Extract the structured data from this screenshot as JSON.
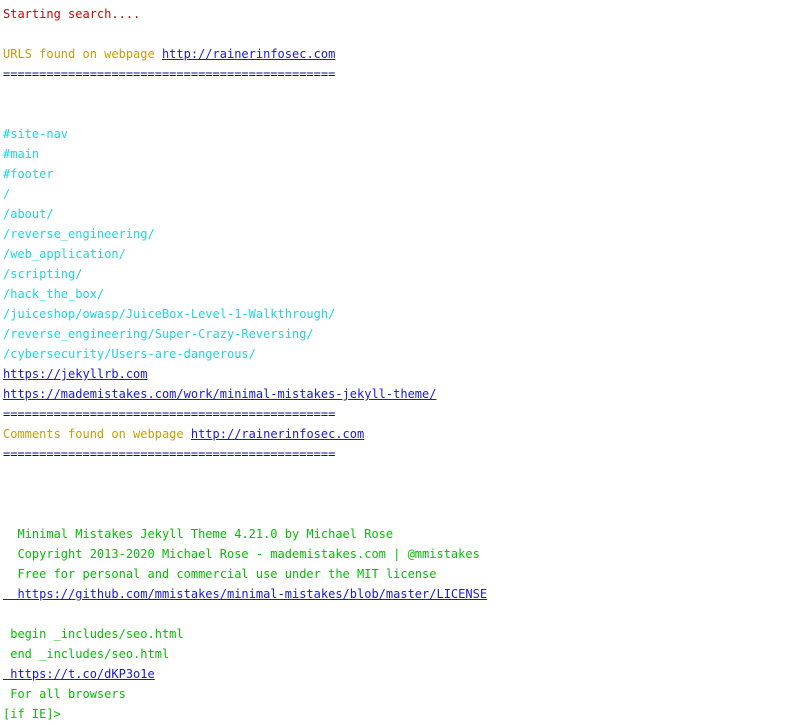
{
  "terminal": {
    "window_background": "#ffffff",
    "palette": {
      "red": "#d00000",
      "yellow": "#c8a000",
      "cyan": "#18d8e0",
      "link_blue": "#1818e0",
      "green": "#00c000",
      "separator_navy": "#101080"
    },
    "lines": [
      {
        "id": "l1",
        "kind": "status",
        "color": "red",
        "text": "Starting search...."
      },
      {
        "id": "l2",
        "kind": "blank",
        "color": "none",
        "text": ""
      },
      {
        "id": "l3",
        "kind": "header",
        "color": "yellow",
        "text": "URLS found on webpage ",
        "link": "http://rainerinfosec.com"
      },
      {
        "id": "l4",
        "kind": "separator",
        "color": "separator_navy",
        "text": "=============================================="
      },
      {
        "id": "l5",
        "kind": "blank",
        "color": "none",
        "text": ""
      },
      {
        "id": "l6",
        "kind": "blank",
        "color": "none",
        "text": ""
      },
      {
        "id": "l7",
        "kind": "url",
        "color": "cyan",
        "text": "#site-nav"
      },
      {
        "id": "l8",
        "kind": "url",
        "color": "cyan",
        "text": "#main"
      },
      {
        "id": "l9",
        "kind": "url",
        "color": "cyan",
        "text": "#footer"
      },
      {
        "id": "l10",
        "kind": "url",
        "color": "cyan",
        "text": "/"
      },
      {
        "id": "l11",
        "kind": "url",
        "color": "cyan",
        "text": "/about/"
      },
      {
        "id": "l12",
        "kind": "url",
        "color": "cyan",
        "text": "/reverse_engineering/"
      },
      {
        "id": "l13",
        "kind": "url",
        "color": "cyan",
        "text": "/web_application/"
      },
      {
        "id": "l14",
        "kind": "url",
        "color": "cyan",
        "text": "/scripting/"
      },
      {
        "id": "l15",
        "kind": "url",
        "color": "cyan",
        "text": "/hack_the_box/"
      },
      {
        "id": "l16",
        "kind": "url",
        "color": "cyan",
        "text": "/juiceshop/owasp/JuiceBox-Level-1-Walkthrough/"
      },
      {
        "id": "l17",
        "kind": "url",
        "color": "cyan",
        "text": "/reverse_engineering/Super-Crazy-Reversing/"
      },
      {
        "id": "l18",
        "kind": "url",
        "color": "cyan",
        "text": "/cybersecurity/Users-are-dangerous/"
      },
      {
        "id": "l19",
        "kind": "link",
        "color": "link_blue",
        "text": "https://jekyllrb.com"
      },
      {
        "id": "l20",
        "kind": "link",
        "color": "link_blue",
        "text": "https://mademistakes.com/work/minimal-mistakes-jekyll-theme/"
      },
      {
        "id": "l21",
        "kind": "separator",
        "color": "separator_navy",
        "text": "=============================================="
      },
      {
        "id": "l22",
        "kind": "header",
        "color": "yellow",
        "text": "Comments found on webpage ",
        "link": "http://rainerinfosec.com"
      },
      {
        "id": "l23",
        "kind": "separator",
        "color": "separator_navy",
        "text": "=============================================="
      },
      {
        "id": "l24",
        "kind": "blank",
        "color": "none",
        "text": ""
      },
      {
        "id": "l25",
        "kind": "blank",
        "color": "none",
        "text": ""
      },
      {
        "id": "l26",
        "kind": "blank",
        "color": "none",
        "text": ""
      },
      {
        "id": "l27",
        "kind": "comment",
        "color": "green",
        "text": "  Minimal Mistakes Jekyll Theme 4.21.0 by Michael Rose"
      },
      {
        "id": "l28",
        "kind": "comment",
        "color": "green",
        "text": "  Copyright 2013-2020 Michael Rose - mademistakes.com | @mmistakes"
      },
      {
        "id": "l29",
        "kind": "comment",
        "color": "green",
        "text": "  Free for personal and commercial use under the MIT license"
      },
      {
        "id": "l30",
        "kind": "link",
        "color": "link_blue",
        "text": "  https://github.com/mmistakes/minimal-mistakes/blob/master/LICENSE"
      },
      {
        "id": "l31",
        "kind": "blank",
        "color": "none",
        "text": ""
      },
      {
        "id": "l32",
        "kind": "comment",
        "color": "green",
        "text": " begin _includes/seo.html"
      },
      {
        "id": "l33",
        "kind": "comment",
        "color": "green",
        "text": " end _includes/seo.html"
      },
      {
        "id": "l34",
        "kind": "link",
        "color": "link_blue",
        "text": " https://t.co/dKP3o1e"
      },
      {
        "id": "l35",
        "kind": "comment",
        "color": "green",
        "text": " For all browsers"
      },
      {
        "id": "l36",
        "kind": "comment",
        "color": "green",
        "text": "[if IE]>"
      }
    ]
  }
}
